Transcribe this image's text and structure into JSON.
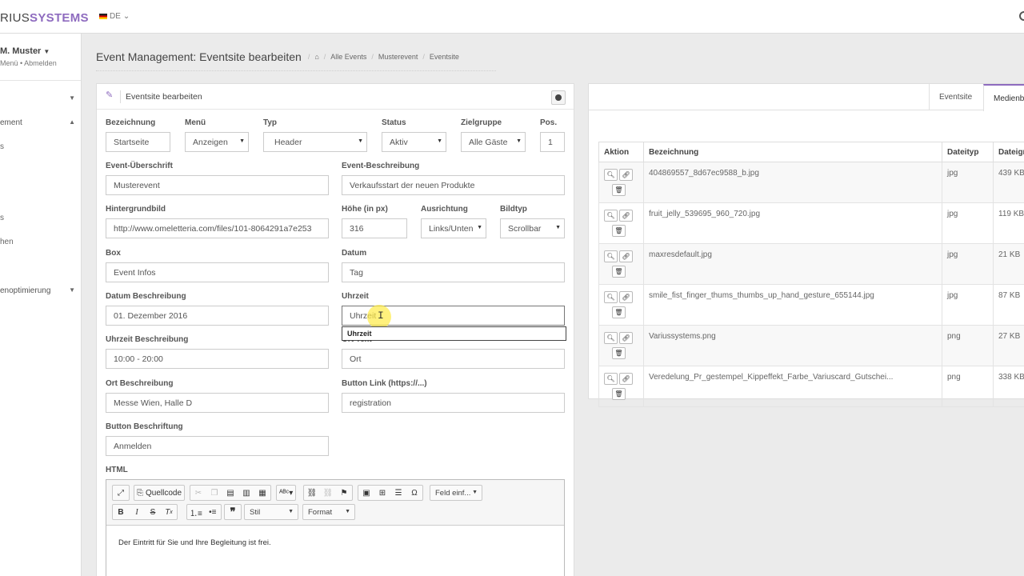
{
  "header": {
    "logo_prefix": "RIUS",
    "logo_suffix": "SYSTEMS",
    "lang": "DE"
  },
  "sidebar": {
    "user_name": "M. Muster",
    "user_menu": "Menü",
    "user_logout": "Abmelden",
    "items": [
      {
        "label": "ement",
        "caret": "▲"
      },
      {
        "label": "s"
      },
      {
        "label": "s"
      },
      {
        "label": "hen"
      },
      {
        "label": "enoptimierung",
        "caret": "▼"
      }
    ]
  },
  "page": {
    "title": "Event Management: Eventsite bearbeiten",
    "breadcrumb": [
      "Alle Events",
      "Musterevent",
      "Eventsite"
    ]
  },
  "form": {
    "panel_title": "Eventsite bearbeiten",
    "bezeichnung": {
      "label": "Bezeichnung",
      "value": "Startseite"
    },
    "menu": {
      "label": "Menü",
      "value": "Anzeigen"
    },
    "typ": {
      "label": "Typ",
      "value": "Header"
    },
    "status": {
      "label": "Status",
      "value": "Aktiv"
    },
    "zielgruppe": {
      "label": "Zielgruppe",
      "value": "Alle Gäste"
    },
    "pos": {
      "label": "Pos.",
      "value": "1"
    },
    "event_ueberschrift": {
      "label": "Event-Überschrift",
      "value": "Musterevent"
    },
    "event_beschreibung": {
      "label": "Event-Beschreibung",
      "value": "Verkaufsstart der neuen Produkte"
    },
    "hintergrundbild": {
      "label": "Hintergrundbild",
      "value": "http://www.omeletteria.com/files/101-8064291a7e253"
    },
    "hoehe": {
      "label": "Höhe (in px)",
      "value": "316"
    },
    "ausrichtung": {
      "label": "Ausrichtung",
      "value": "Links/Unten"
    },
    "bildtyp": {
      "label": "Bildtyp",
      "value": "Scrollbar"
    },
    "box": {
      "label": "Box",
      "value": "Event Infos"
    },
    "datum": {
      "label": "Datum",
      "value": "Tag"
    },
    "datum_beschreibung": {
      "label": "Datum Beschreibung",
      "value": "01. Dezember 2016"
    },
    "uhrzeit": {
      "label": "Uhrzeit",
      "value": "Uhrzeit",
      "suggestion": "Uhrzeit"
    },
    "uhrzeit_beschreibung": {
      "label": "Uhrzeit Beschreibung",
      "value": "10:00 - 20:00"
    },
    "ort_text": {
      "label": "Ort Text",
      "value": "Ort"
    },
    "ort_beschreibung": {
      "label": "Ort Beschreibung",
      "value": "Messe Wien, Halle D"
    },
    "button_link": {
      "label": "Button Link (https://...)",
      "value": "registration"
    },
    "button_beschriftung": {
      "label": "Button Beschriftung",
      "value": "Anmelden"
    },
    "html": {
      "label": "HTML",
      "source_label": "Quellcode",
      "feld_label": "Feld einf...",
      "stil_label": "Stil",
      "format_label": "Format",
      "content": "Der Eintritt für Sie und Ihre Begleitung ist frei."
    }
  },
  "media": {
    "tabs": [
      "Eventsite",
      "Medienb"
    ],
    "columns": [
      "Aktion",
      "Bezeichnung",
      "Dateityp",
      "Dateigr"
    ],
    "rows": [
      {
        "name": "404869557_8d67ec9588_b.jpg",
        "type": "jpg",
        "size": "439 KB"
      },
      {
        "name": "fruit_jelly_539695_960_720.jpg",
        "type": "jpg",
        "size": "119 KB"
      },
      {
        "name": "maxresdefault.jpg",
        "type": "jpg",
        "size": "21 KB"
      },
      {
        "name": "smile_fist_finger_thums_thumbs_up_hand_gesture_655144.jpg",
        "type": "jpg",
        "size": "87 KB"
      },
      {
        "name": "Variussystems.png",
        "type": "png",
        "size": "27 KB"
      },
      {
        "name": "Veredelung_Pr_gestempel_Kippeffekt_Farbe_Variuscard_Gutschei...",
        "type": "png",
        "size": "338 KB"
      }
    ]
  },
  "colors": {
    "accent": "#8e6bbf"
  }
}
